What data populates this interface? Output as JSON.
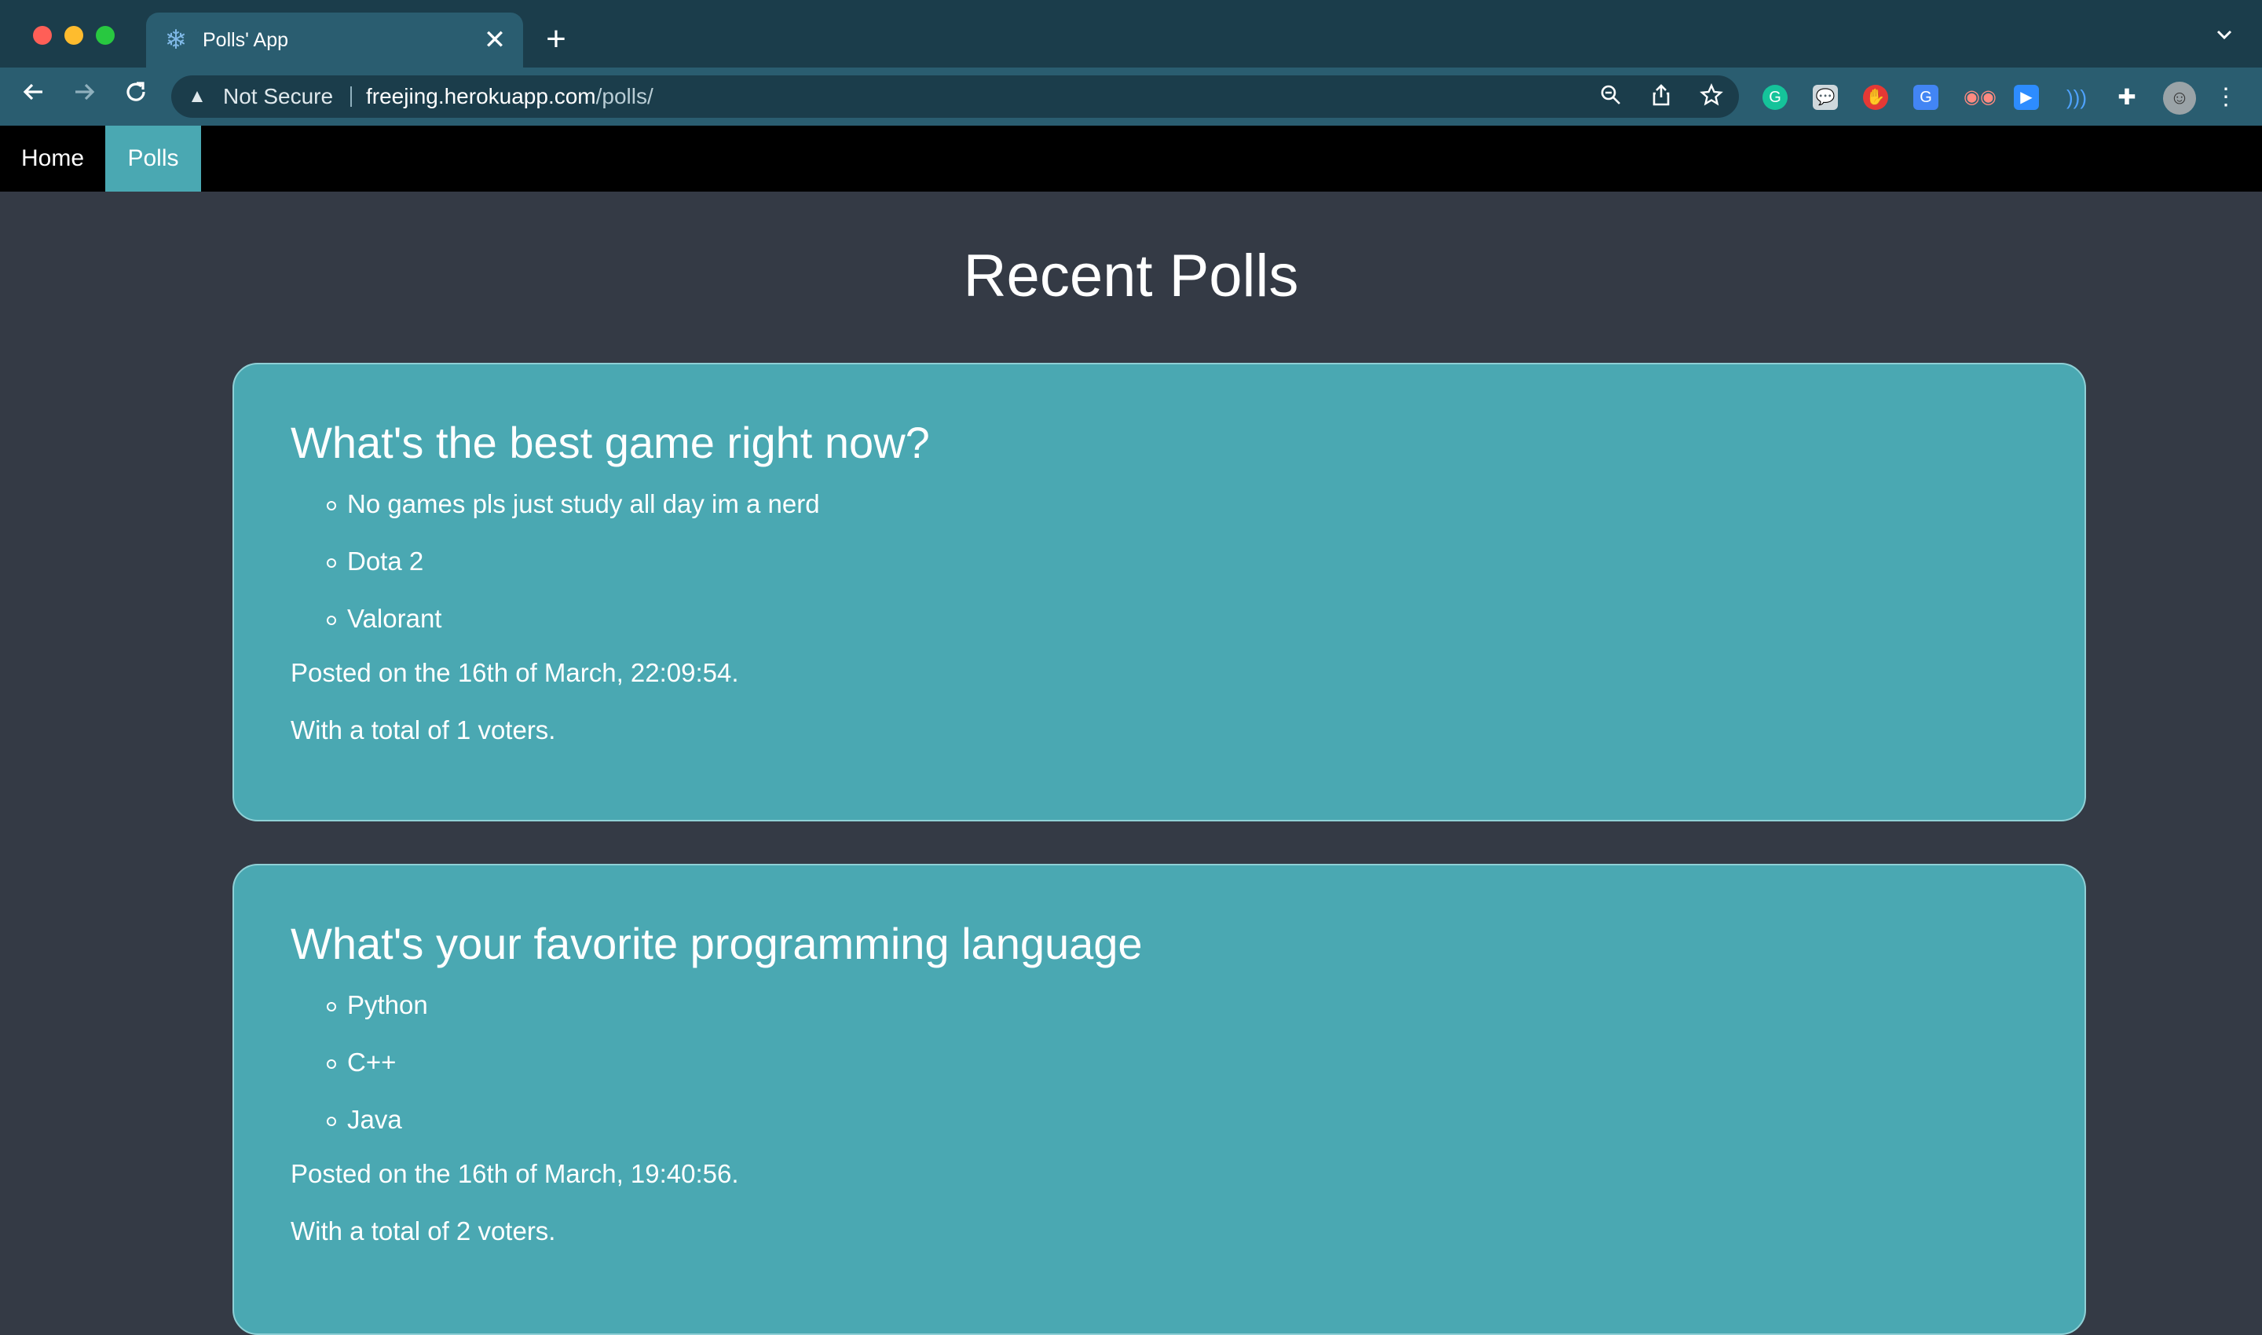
{
  "browser": {
    "tab_title": "Polls' App",
    "tab_close": "✕",
    "new_tab": "+",
    "security_label": "Not Secure",
    "url_host": "freejing.herokuapp.com",
    "url_path": "/polls/"
  },
  "navbar": {
    "home_label": "Home",
    "polls_label": "Polls",
    "active": "Polls"
  },
  "page": {
    "title": "Recent Polls"
  },
  "polls": [
    {
      "question": "What's the best game right now?",
      "choices": [
        "No games pls just study all day im a nerd",
        "Dota 2",
        "Valorant"
      ],
      "posted": "Posted on the 16th of March, 22:09:54.",
      "voters": "With a total of 1 voters."
    },
    {
      "question": "What's your favorite programming language",
      "choices": [
        "Python",
        "C++",
        "Java"
      ],
      "posted": "Posted on the 16th of March, 19:40:56.",
      "voters": "With a total of 2 voters."
    }
  ],
  "colors": {
    "page_background": "#343a45",
    "card_background": "#4aa8b2",
    "navbar_background": "#000000",
    "active_nav": "#4aa8b2",
    "chrome_background": "#1b3d4b",
    "toolbar_background": "#2a5d70"
  },
  "icons": {
    "favicon": "snowflake-icon",
    "extensions": [
      "grammarly-icon",
      "chat-icon",
      "adblock-icon",
      "translate-icon",
      "spy-icon",
      "zoom-icon",
      "sound-icon",
      "puzzle-icon",
      "profile-avatar",
      "kebab-menu-icon"
    ]
  }
}
